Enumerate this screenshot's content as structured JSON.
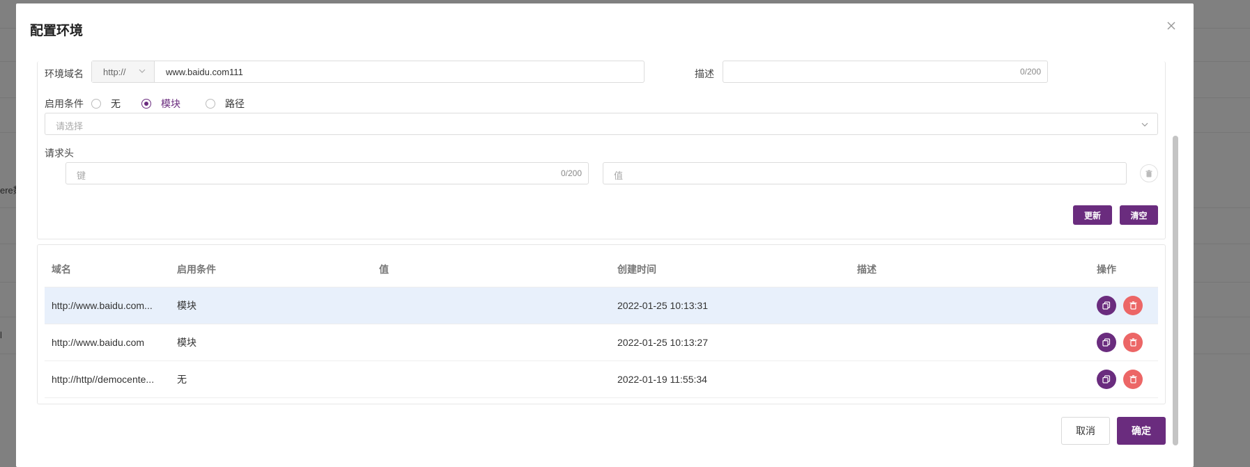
{
  "background": {
    "frag_top": "",
    "frag_mid": "ere数",
    "frag_low": "l"
  },
  "modal": {
    "title": "配置环境",
    "close_icon": "close-icon"
  },
  "form": {
    "domain_label": "环境域名",
    "protocol_value": "http://",
    "domain_value": "www.baidu.com111",
    "desc_label": "描述",
    "desc_counter": "0/200",
    "condition_label": "启用条件",
    "radio_options": [
      "无",
      "模块",
      "路径"
    ],
    "radio_selected": "模块",
    "select_placeholder": "请选择",
    "header_label": "请求头",
    "key_placeholder": "键",
    "key_counter": "0/200",
    "value_placeholder": "值",
    "update_button": "更新",
    "clear_button": "清空"
  },
  "table": {
    "columns": [
      "域名",
      "启用条件",
      "值",
      "创建时间",
      "描述",
      "操作"
    ],
    "rows": [
      {
        "domain": "http://www.baidu.com...",
        "condition": "模块",
        "value": "",
        "created": "2022-01-25 10:13:31",
        "desc": ""
      },
      {
        "domain": "http://www.baidu.com",
        "condition": "模块",
        "value": "",
        "created": "2022-01-25 10:13:27",
        "desc": ""
      },
      {
        "domain": "http://http//democente...",
        "condition": "无",
        "value": "",
        "created": "2022-01-19 11:55:34",
        "desc": ""
      }
    ]
  },
  "footer": {
    "cancel": "取消",
    "confirm": "确定"
  },
  "colors": {
    "primary": "#6a2c7e",
    "danger": "#ec6666",
    "row_highlight": "#e8f0fb"
  }
}
